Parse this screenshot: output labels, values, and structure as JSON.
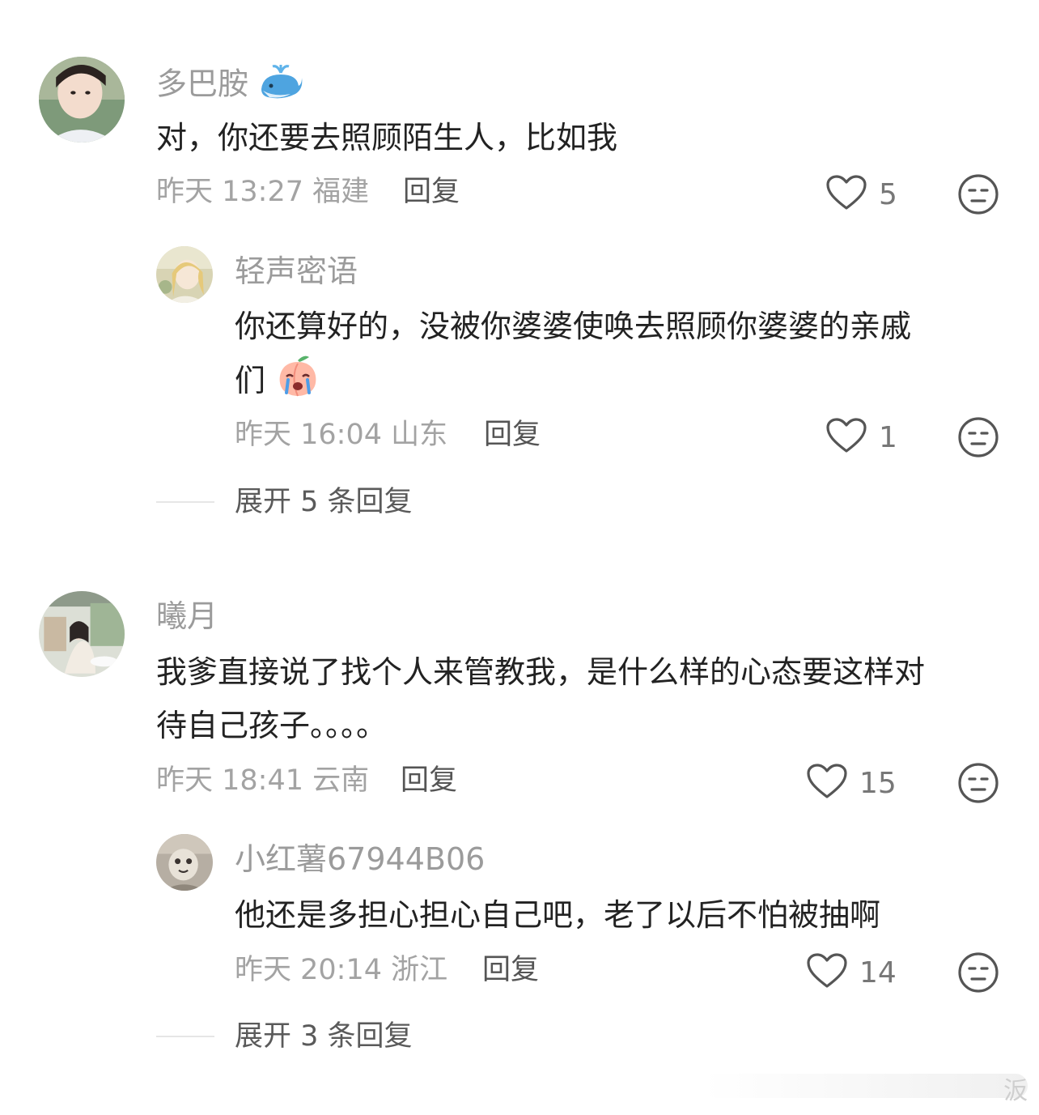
{
  "comments": [
    {
      "username": "多巴胺",
      "username_icon": "whale-emoji-icon",
      "text": "对，你还要去照顾陌生人，比如我",
      "time": "昨天 13:27 福建",
      "reply_label": "回复",
      "likes": "5",
      "avatar_color": "#c9d9e6"
    },
    {
      "username": "轻声密语",
      "text": "你还算好的，没被你婆婆使唤去照顾你婆婆的亲戚",
      "text_line2": "们",
      "text_emoji": "crying-peach-emoji-icon",
      "time": "昨天 16:04 山东",
      "reply_label": "回复",
      "likes": "1",
      "avatar_color": "#e3d9b8"
    },
    {
      "username": "曦月",
      "text": "我爹直接说了找个人来管教我，是什么样的心态要这样对",
      "text_line2": "待自己孩子。。。。",
      "time": "昨天 18:41 云南",
      "reply_label": "回复",
      "likes": "15",
      "avatar_color": "#c8cfc2"
    },
    {
      "username": "小红薯67944B06",
      "text": "他还是多担心担心自己吧，老了以后不怕被抽啊",
      "time": "昨天 20:14 浙江",
      "reply_label": "回复",
      "likes": "14",
      "avatar_color": "#b9b2a8"
    }
  ],
  "expand_1": "展开 5 条回复",
  "expand_2": "展开 3 条回复",
  "watermark": "汳"
}
